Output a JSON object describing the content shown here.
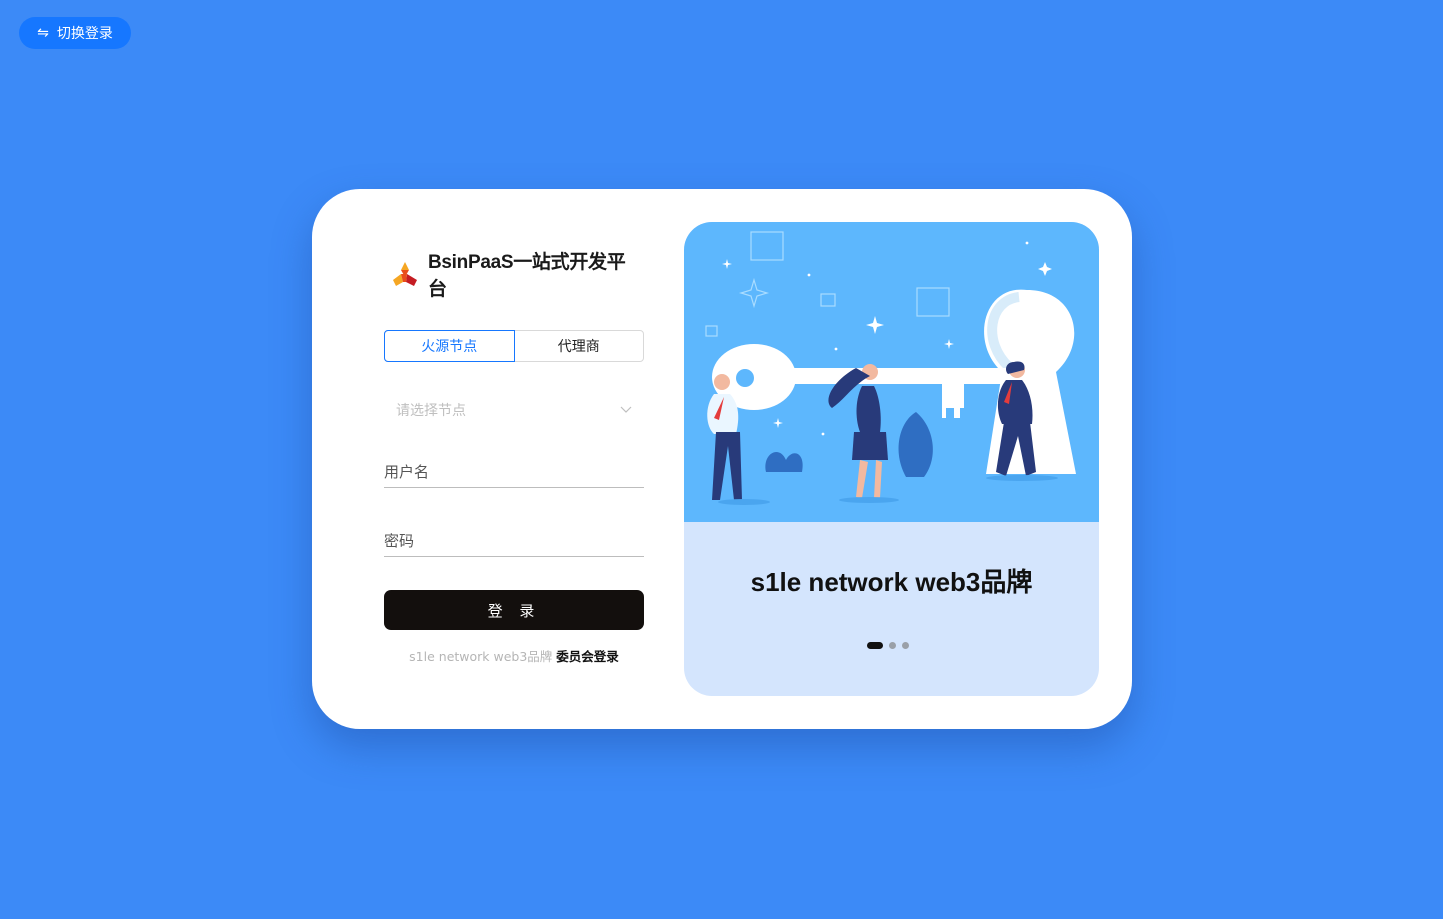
{
  "header": {
    "switch_label": "切换登录",
    "switch_icon": "swap-arrows-icon"
  },
  "brand": {
    "title": "BsinPaaS一站式开发平台",
    "logo": "bsin-logo"
  },
  "tabs": [
    {
      "label": "火源节点",
      "active": true
    },
    {
      "label": "代理商",
      "active": false
    }
  ],
  "node_select": {
    "placeholder": "请选择节点"
  },
  "username": {
    "placeholder": "用户名",
    "value": ""
  },
  "password": {
    "placeholder": "密码",
    "value": ""
  },
  "login_button": {
    "label": "登 录"
  },
  "footer": {
    "prefix": "s1le network web3品牌",
    "link": "委员会登录"
  },
  "carousel": {
    "title": "s1le network web3品牌",
    "slide_count": 3,
    "active_index": 0
  },
  "colors": {
    "background": "#3c8af7",
    "accent": "#1677ff",
    "button": "#130f0d",
    "illustration_bg": "#5db7fd",
    "panel_bg": "#d4e5fd"
  }
}
